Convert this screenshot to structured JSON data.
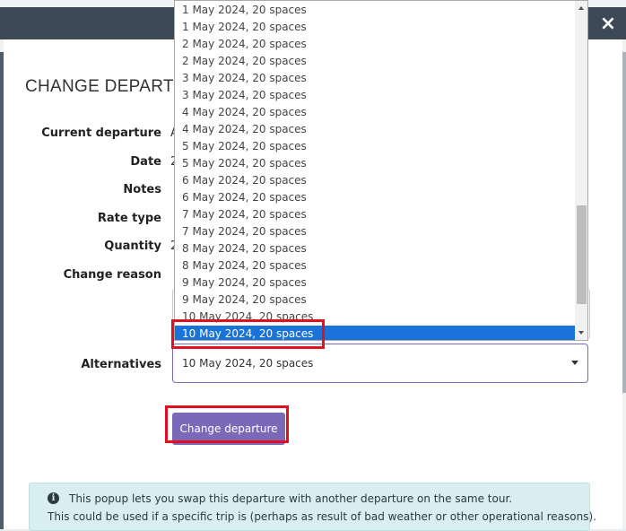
{
  "modal": {
    "close_label": "×",
    "title": "CHANGE DEPARTURE",
    "fields": [
      {
        "label": "Current departure",
        "value": "A"
      },
      {
        "label": "Date",
        "value": "2"
      },
      {
        "label": "Notes",
        "value": ""
      },
      {
        "label": "Rate type",
        "value": ""
      },
      {
        "label": "Quantity",
        "value": "2"
      },
      {
        "label": "Change reason",
        "value": ""
      }
    ],
    "alternatives": {
      "label": "Alternatives",
      "selected": "10 May 2024, 20 spaces",
      "options": [
        "1 May 2024, 20 spaces",
        "1 May 2024, 20 spaces",
        "2 May 2024, 20 spaces",
        "2 May 2024, 20 spaces",
        "3 May 2024, 20 spaces",
        "3 May 2024, 20 spaces",
        "4 May 2024, 20 spaces",
        "4 May 2024, 20 spaces",
        "5 May 2024, 20 spaces",
        "5 May 2024, 20 spaces",
        "6 May 2024, 20 spaces",
        "6 May 2024, 20 spaces",
        "7 May 2024, 20 spaces",
        "7 May 2024, 20 spaces",
        "8 May 2024, 20 spaces",
        "8 May 2024, 20 spaces",
        "9 May 2024, 20 spaces",
        "9 May 2024, 20 spaces",
        "10 May 2024, 20 spaces"
      ],
      "highlighted_option": "10 May 2024, 20 spaces"
    },
    "submit_label": "Change departure",
    "info": {
      "icon": "info-icon",
      "line1": "This popup lets you swap this departure with another departure on the same tour.",
      "line2": "This could be used if a specific trip is (perhaps as result of bad weather or other operational reasons)."
    }
  },
  "colors": {
    "header": "#3d4a55",
    "button": "#7a68b8",
    "selected_option": "#1a73d9",
    "highlight_box": "#e01020",
    "info_bg": "#d8eef1"
  }
}
